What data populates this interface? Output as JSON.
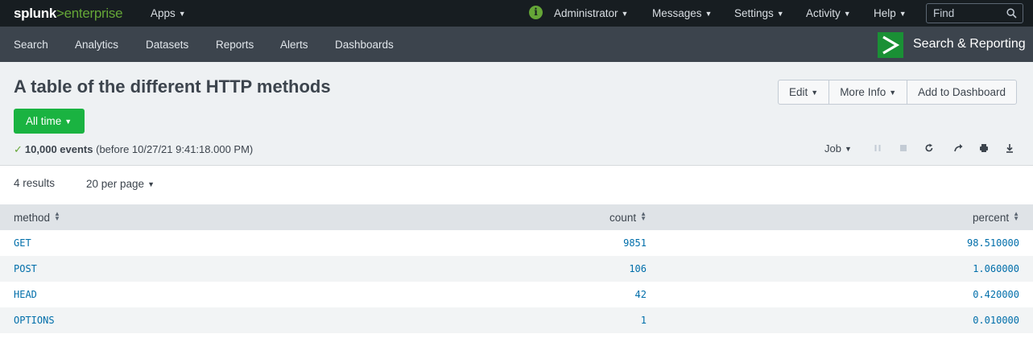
{
  "topbar": {
    "logo_part1": "splunk",
    "logo_part2": ">enterprise",
    "apps_label": "Apps",
    "user_label": "Administrator",
    "messages_label": "Messages",
    "settings_label": "Settings",
    "activity_label": "Activity",
    "help_label": "Help",
    "find_placeholder": "Find"
  },
  "appbar": {
    "nav": [
      "Search",
      "Analytics",
      "Datasets",
      "Reports",
      "Alerts",
      "Dashboards"
    ],
    "app_title": "Search & Reporting",
    "app_logo_glyph": ">"
  },
  "header": {
    "title": "A table of the different HTTP methods",
    "edit_label": "Edit",
    "more_info_label": "More Info",
    "add_dashboard_label": "Add to Dashboard",
    "time_range_label": "All time",
    "events_count": "10,000 events",
    "events_detail": "(before 10/27/21 9:41:18.000 PM)",
    "job_label": "Job"
  },
  "results": {
    "count_label": "4 results",
    "per_page_label": "20 per page",
    "columns": [
      "method",
      "count",
      "percent"
    ],
    "rows": [
      [
        "GET",
        "9851",
        "98.510000"
      ],
      [
        "POST",
        "106",
        "1.060000"
      ],
      [
        "HEAD",
        "42",
        "0.420000"
      ],
      [
        "OPTIONS",
        "1",
        "0.010000"
      ]
    ]
  },
  "colors": {
    "topbar_bg": "#171d21",
    "appbar_bg": "#3c444d",
    "accent_green": "#1ab341",
    "link_blue": "#006eaa"
  },
  "icons": [
    "info-icon",
    "search-icon",
    "app-logo-icon",
    "pause-icon",
    "stop-icon",
    "refresh-icon",
    "share-icon",
    "print-icon",
    "export-icon",
    "sort-icon"
  ]
}
